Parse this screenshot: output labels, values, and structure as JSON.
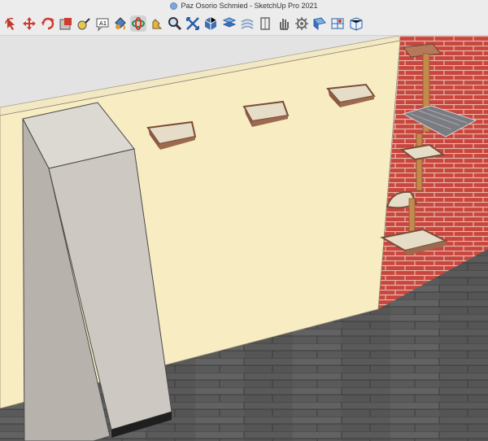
{
  "window": {
    "title": "Paz Osorio Schmied - SketchUp Pro 2021"
  },
  "toolbar": {
    "tools": [
      {
        "icon": "select-arrow-icon"
      },
      {
        "icon": "move-icon"
      },
      {
        "icon": "rotate-icon"
      },
      {
        "icon": "scale-icon"
      },
      {
        "icon": "tape-measure-icon"
      },
      {
        "icon": "text-icon"
      },
      {
        "icon": "paint-bucket-icon"
      },
      {
        "icon": "orbit-icon",
        "active": true
      },
      {
        "icon": "pan-icon"
      },
      {
        "icon": "zoom-icon"
      },
      {
        "icon": "zoom-extents-icon"
      },
      {
        "icon": "components-icon"
      },
      {
        "icon": "section-plane-icon"
      },
      {
        "icon": "layers-icon"
      },
      {
        "icon": "display-section-icon"
      },
      {
        "icon": "hand-icon"
      },
      {
        "icon": "settings-gear-icon"
      },
      {
        "icon": "match-photo-icon"
      },
      {
        "icon": "geo-location-icon"
      },
      {
        "icon": "extension-warehouse-icon"
      }
    ]
  },
  "colors": {
    "wall": "#f8ecc3",
    "brick": "#c8463e",
    "floor": "#5c5c5c",
    "cabinet": "#cfcac3",
    "shelf_wood": "#9b6a4f",
    "shelf_pad": "#e6ddc8",
    "pole": "#c48a4c",
    "hammock": "#7b7b82"
  }
}
